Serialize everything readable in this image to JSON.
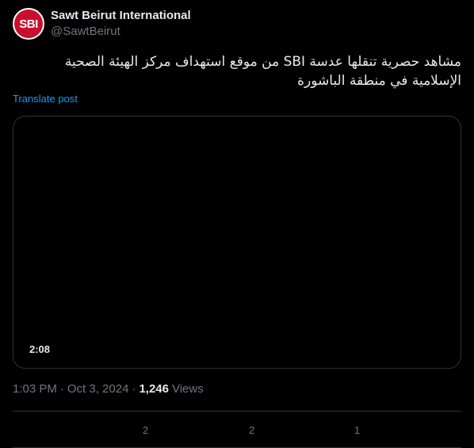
{
  "author": {
    "avatar_text": "SBI",
    "display_name": "Sawt Beirut International",
    "handle": "@SawtBeirut"
  },
  "post": {
    "text": "مشاهد حصرية تنقلها عدسة SBI من موقع استهداف مركز  الهيئة الصحية الإسلامية في منطقة الباشورة",
    "translate_label": "Translate post"
  },
  "media": {
    "duration": "2:08"
  },
  "meta": {
    "time": "1:03 PM",
    "separator": "·",
    "date": "Oct 3, 2024",
    "views_count": "1,246",
    "views_label": "Views"
  },
  "actions": {
    "replies": "2",
    "reposts": "2",
    "likes": "1"
  },
  "colors": {
    "background": "#000000",
    "text": "#e7e9ea",
    "muted": "#71767b",
    "link": "#1d9bf0",
    "avatar": "#c8102e"
  }
}
